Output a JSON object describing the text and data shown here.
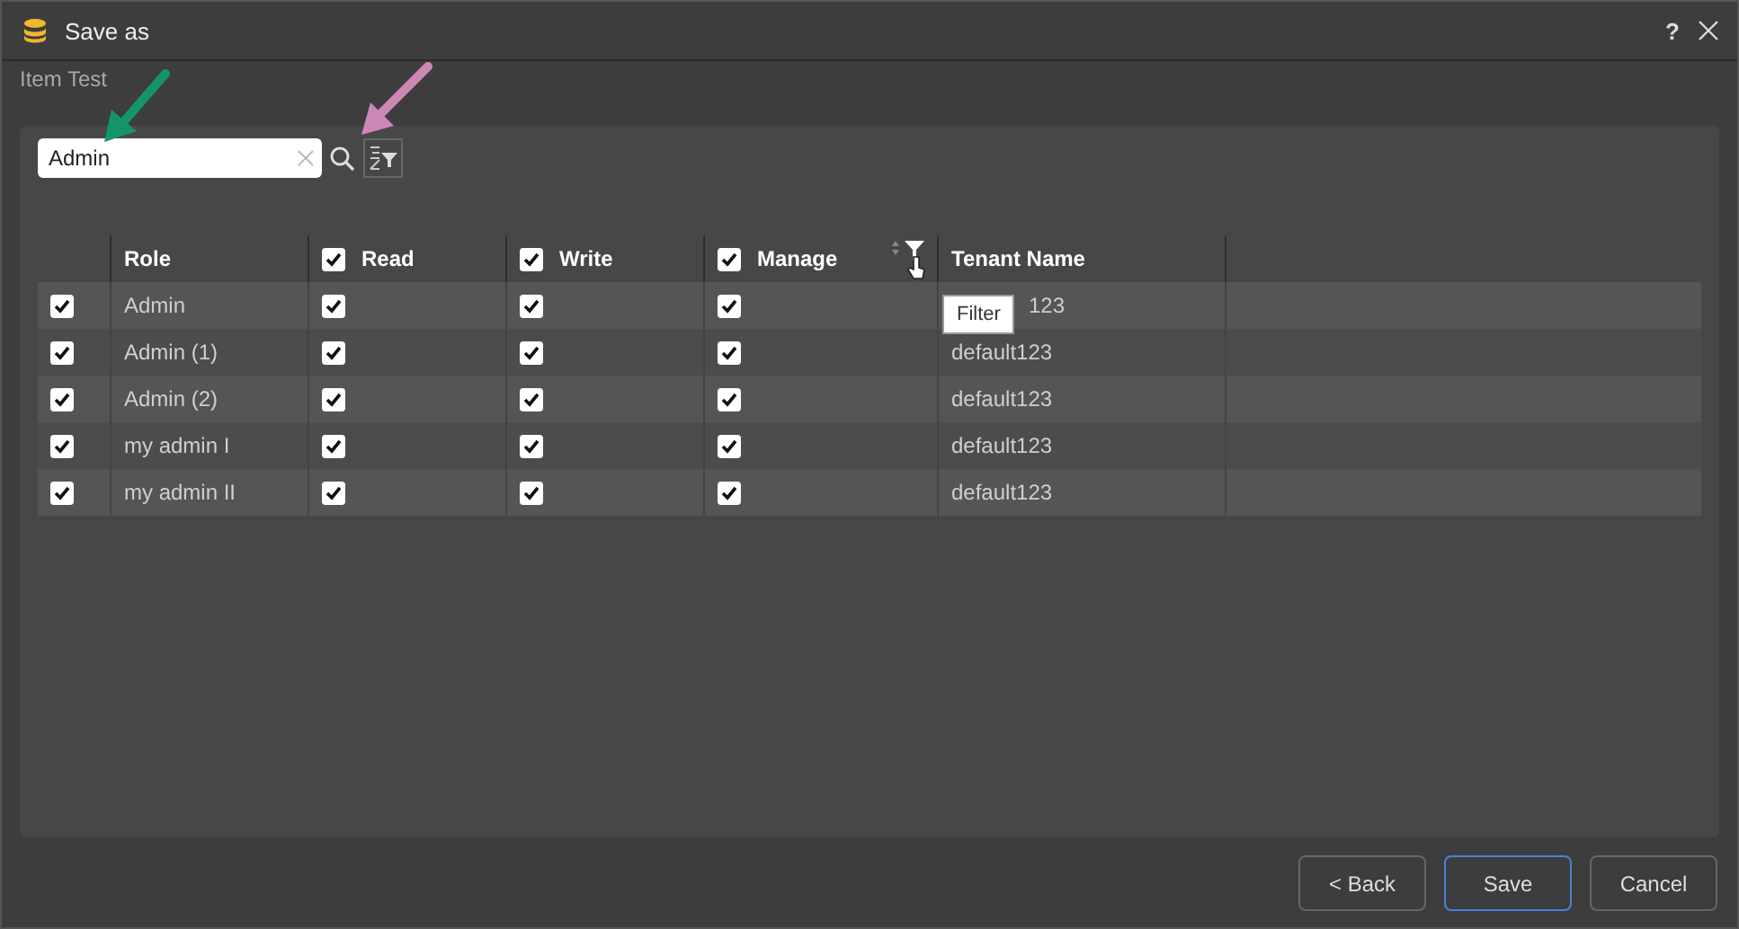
{
  "window": {
    "title": "Save as",
    "help": "?"
  },
  "subtitle": "Item Test",
  "search": {
    "value": "Admin"
  },
  "table": {
    "columns": [
      {
        "label": "Role"
      },
      {
        "label": "Read",
        "checked": true
      },
      {
        "label": "Write",
        "checked": true
      },
      {
        "label": "Manage",
        "checked": true
      },
      {
        "label": "Tenant Name"
      }
    ],
    "rows": [
      {
        "checked": true,
        "role": "Admin",
        "read": true,
        "write": true,
        "manage": true,
        "tenant": "123"
      },
      {
        "checked": true,
        "role": "Admin (1)",
        "read": true,
        "write": true,
        "manage": true,
        "tenant": "default123"
      },
      {
        "checked": true,
        "role": "Admin (2)",
        "read": true,
        "write": true,
        "manage": true,
        "tenant": "default123"
      },
      {
        "checked": true,
        "role": "my admin I",
        "read": true,
        "write": true,
        "manage": true,
        "tenant": "default123"
      },
      {
        "checked": true,
        "role": "my admin II",
        "read": true,
        "write": true,
        "manage": true,
        "tenant": "default123"
      }
    ]
  },
  "tooltip": "Filter",
  "buttons": [
    {
      "label": "< Back",
      "selected": false
    },
    {
      "label": "Save",
      "selected": true
    },
    {
      "label": "Cancel",
      "selected": false
    }
  ]
}
